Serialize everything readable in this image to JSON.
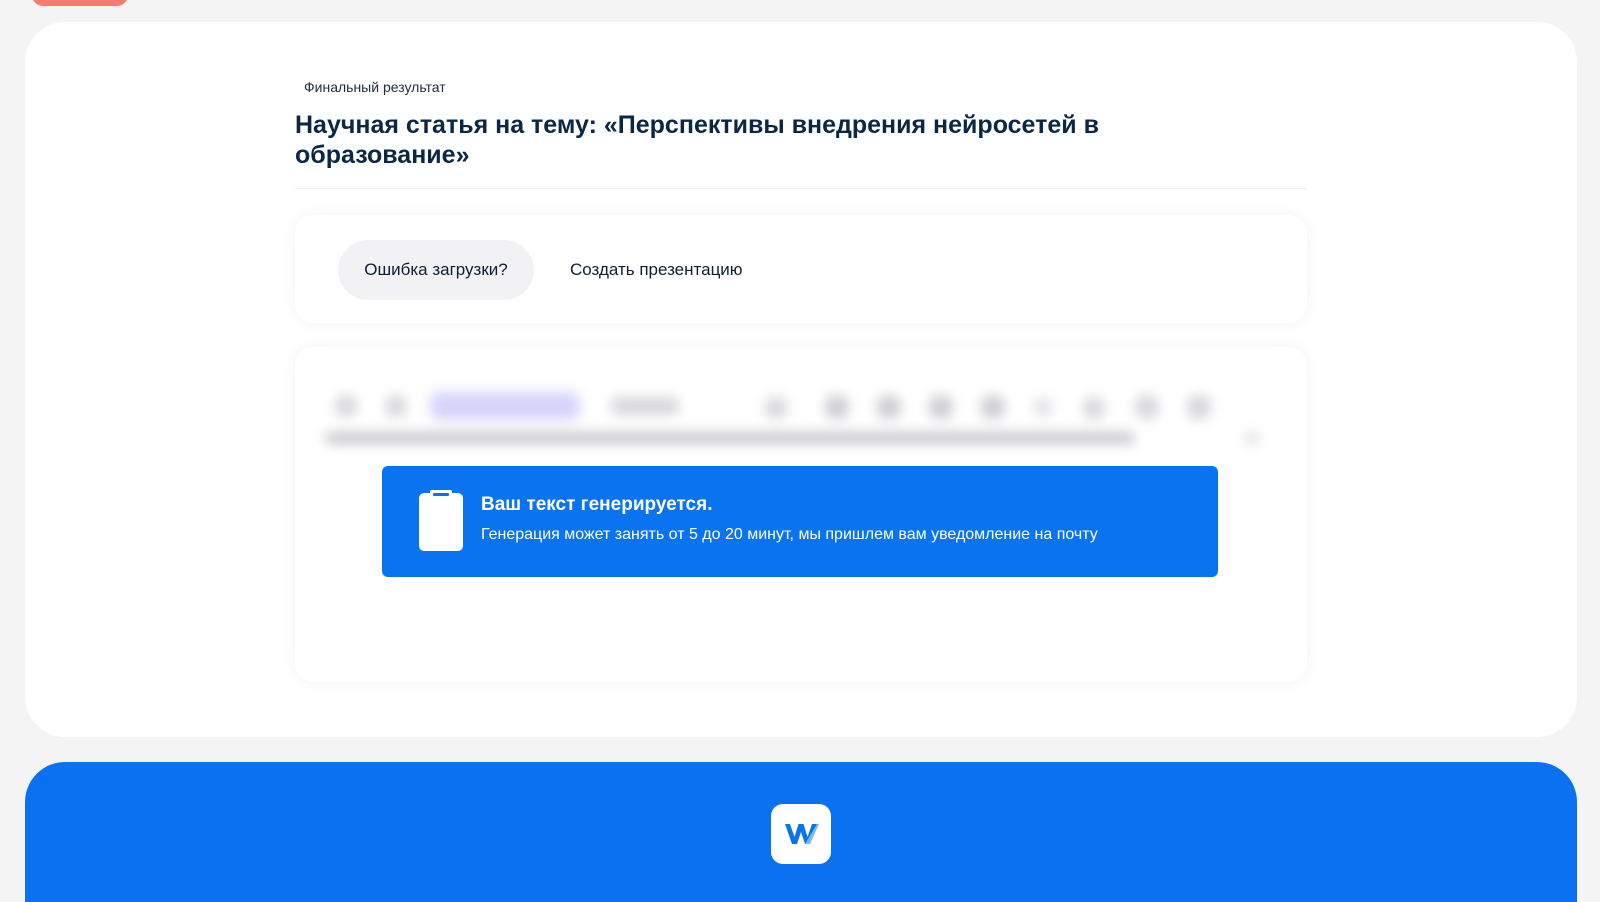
{
  "header": {
    "kicker": "Финальный результат",
    "title": "Научная статья на тему: «Перспективы внедрения нейросетей в образование»"
  },
  "actions": {
    "error_label": "Ошибка загрузки?",
    "presentation_label": "Создать презентацию"
  },
  "notice": {
    "title": "Ваш текст генерируется.",
    "text": "Генерация может занять от 5 до 20 минут, мы пришлем вам уведомление на почту",
    "icon": "clipboard-icon"
  },
  "footer": {
    "logo_icon": "w-logo-icon"
  },
  "colors": {
    "accent": "#0a74f0",
    "title": "#0c2744",
    "top_pill": "#f47a72"
  }
}
